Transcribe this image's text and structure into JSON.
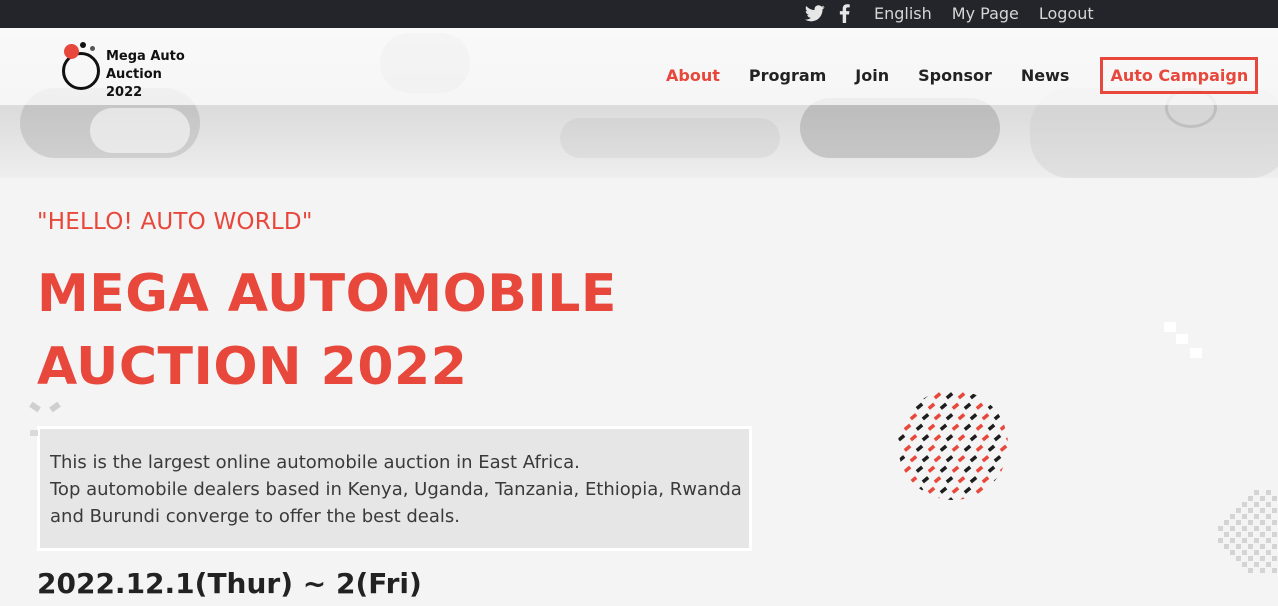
{
  "topbar": {
    "social": [
      {
        "name": "twitter-icon"
      },
      {
        "name": "facebook-icon"
      }
    ],
    "links": [
      {
        "label": "English"
      },
      {
        "label": "My Page"
      },
      {
        "label": "Logout"
      }
    ]
  },
  "logo": {
    "line1": "Mega Auto",
    "line2": "Auction 2022"
  },
  "nav": {
    "items": [
      {
        "label": "About"
      },
      {
        "label": "Program"
      },
      {
        "label": "Join"
      },
      {
        "label": "Sponsor"
      },
      {
        "label": "News"
      }
    ],
    "campaign_label": "Auto Campaign"
  },
  "hero": {
    "tagline": "\"HELLO! AUTO WORLD\"",
    "title_line1": "MEGA AUTOMOBILE",
    "title_line2": "AUCTION 2022",
    "description": [
      "This is the largest online automobile auction in East Africa.",
      "Top automobile dealers based in Kenya, Uganda, Tanzania, Ethiopia, Rwanda",
      "and Burundi converge to offer the best deals."
    ],
    "date": "2022.12.1(Thur) ~ 2(Fri)"
  },
  "colors": {
    "accent": "#e8473b",
    "topbar": "#23252b",
    "text": "#222222"
  }
}
